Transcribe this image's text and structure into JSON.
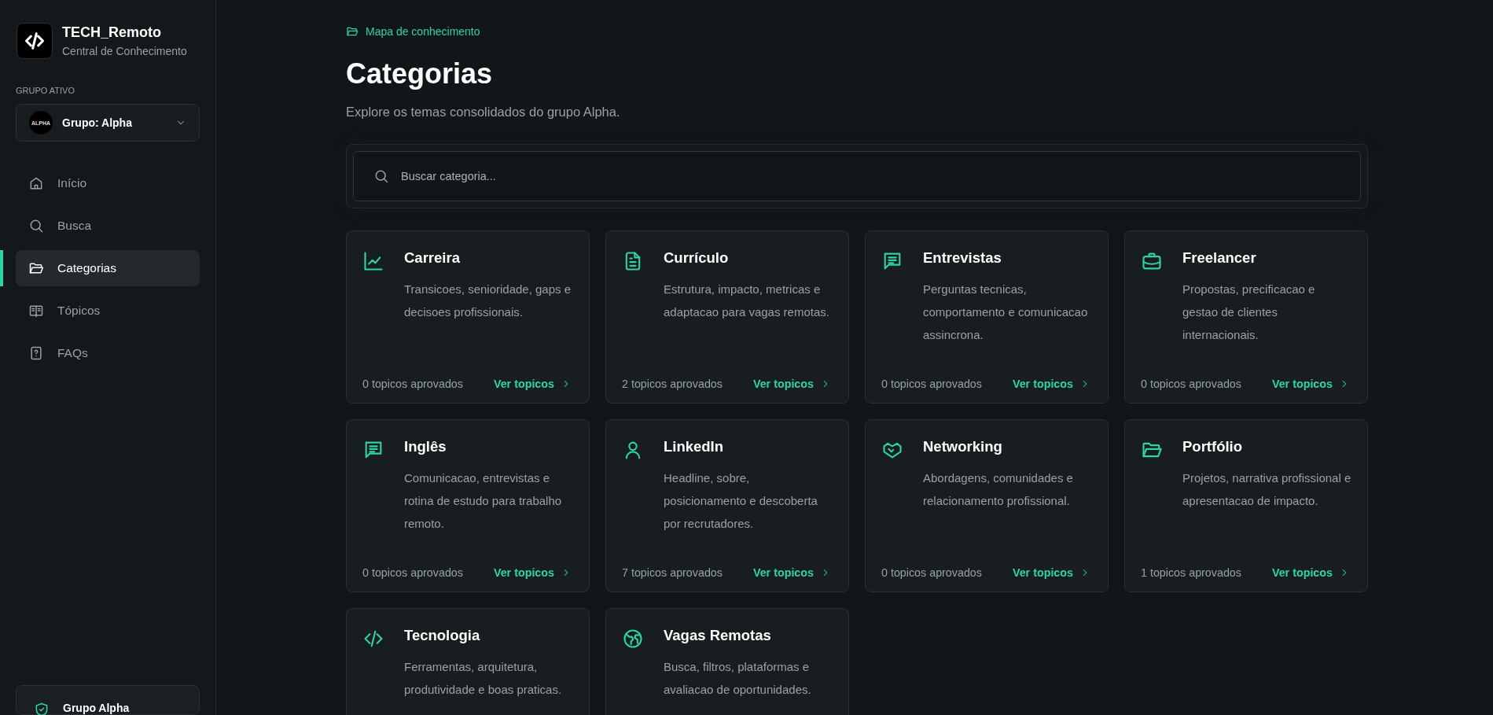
{
  "sidebar": {
    "brand": {
      "title": "TECH_Remoto",
      "subtitle": "Central de Conhecimento"
    },
    "group_label": "GRUPO ATIVO",
    "group_select": {
      "badge": "ALPHA",
      "value": "Grupo: Alpha"
    },
    "nav": [
      {
        "label": "Início",
        "selected": false
      },
      {
        "label": "Busca",
        "selected": false
      },
      {
        "label": "Categorias",
        "selected": true
      },
      {
        "label": "Tópicos",
        "selected": false
      },
      {
        "label": "FAQs",
        "selected": false
      }
    ],
    "footer": {
      "title": "Grupo Alpha"
    }
  },
  "main": {
    "breadcrumb": "Mapa de conhecimento",
    "title": "Categorias",
    "subtitle": "Explore os temas consolidados do grupo Alpha.",
    "search": {
      "placeholder": "Buscar categoria..."
    },
    "categories": [
      {
        "title": "Carreira",
        "description": "Transicoes, senioridade, gaps e decisoes profissionais.",
        "count": "0 topicos aprovados",
        "link": "Ver topicos"
      },
      {
        "title": "Currículo",
        "description": "Estrutura, impacto, metricas e adaptacao para vagas remotas.",
        "count": "2 topicos aprovados",
        "link": "Ver topicos"
      },
      {
        "title": "Entrevistas",
        "description": "Perguntas tecnicas, comportamento e comunicacao assincrona.",
        "count": "0 topicos aprovados",
        "link": "Ver topicos"
      },
      {
        "title": "Freelancer",
        "description": "Propostas, precificacao e gestao de clientes internacionais.",
        "count": "0 topicos aprovados",
        "link": "Ver topicos"
      },
      {
        "title": "Inglês",
        "description": "Comunicacao, entrevistas e rotina de estudo para trabalho remoto.",
        "count": "0 topicos aprovados",
        "link": "Ver topicos"
      },
      {
        "title": "LinkedIn",
        "description": "Headline, sobre, posicionamento e descoberta por recrutadores.",
        "count": "7 topicos aprovados",
        "link": "Ver topicos"
      },
      {
        "title": "Networking",
        "description": "Abordagens, comunidades e relacionamento profissional.",
        "count": "0 topicos aprovados",
        "link": "Ver topicos"
      },
      {
        "title": "Portfólio",
        "description": "Projetos, narrativa profissional e apresentacao de impacto.",
        "count": "1 topicos aprovados",
        "link": "Ver topicos"
      },
      {
        "title": "Tecnologia",
        "description": "Ferramentas, arquitetura, produtividade e boas praticas."
      },
      {
        "title": "Vagas Remotas",
        "description": "Busca, filtros, plataformas e avaliacao de oportunidades."
      }
    ]
  }
}
